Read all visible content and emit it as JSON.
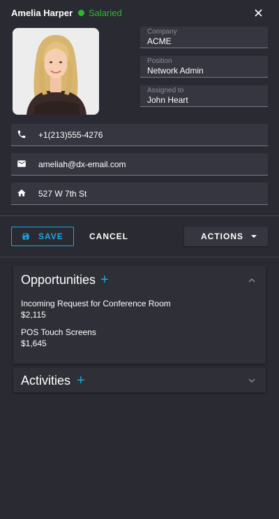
{
  "header": {
    "name": "Amelia Harper",
    "status": "Salaried",
    "status_color": "#2eb82e"
  },
  "profile": {
    "photo_alt": "Amelia Harper"
  },
  "fields": {
    "company": {
      "label": "Company",
      "value": "ACME"
    },
    "position": {
      "label": "Position",
      "value": "Network Admin"
    },
    "assigned": {
      "label": "Assigned to",
      "value": "John Heart"
    }
  },
  "contacts": {
    "phone": {
      "icon": "phone-icon",
      "value": "+1(213)555-4276"
    },
    "email": {
      "icon": "mail-icon",
      "value": "ameliah@dx-email.com"
    },
    "address": {
      "icon": "home-icon",
      "value": "527 W 7th St"
    }
  },
  "toolbar": {
    "save_label": "SAVE",
    "cancel_label": "CANCEL",
    "actions_label": "ACTIONS"
  },
  "opportunities": {
    "title": "Opportunities",
    "add": "+",
    "items": [
      {
        "name": "Incoming Request for Conference Room",
        "amount": "$2,115"
      },
      {
        "name": "POS Touch Screens",
        "amount": "$1,645"
      }
    ]
  },
  "activities": {
    "title": "Activities",
    "add": "+"
  },
  "colors": {
    "accent": "#1ca8dd",
    "background": "#2a2a33",
    "surface": "#363640"
  }
}
